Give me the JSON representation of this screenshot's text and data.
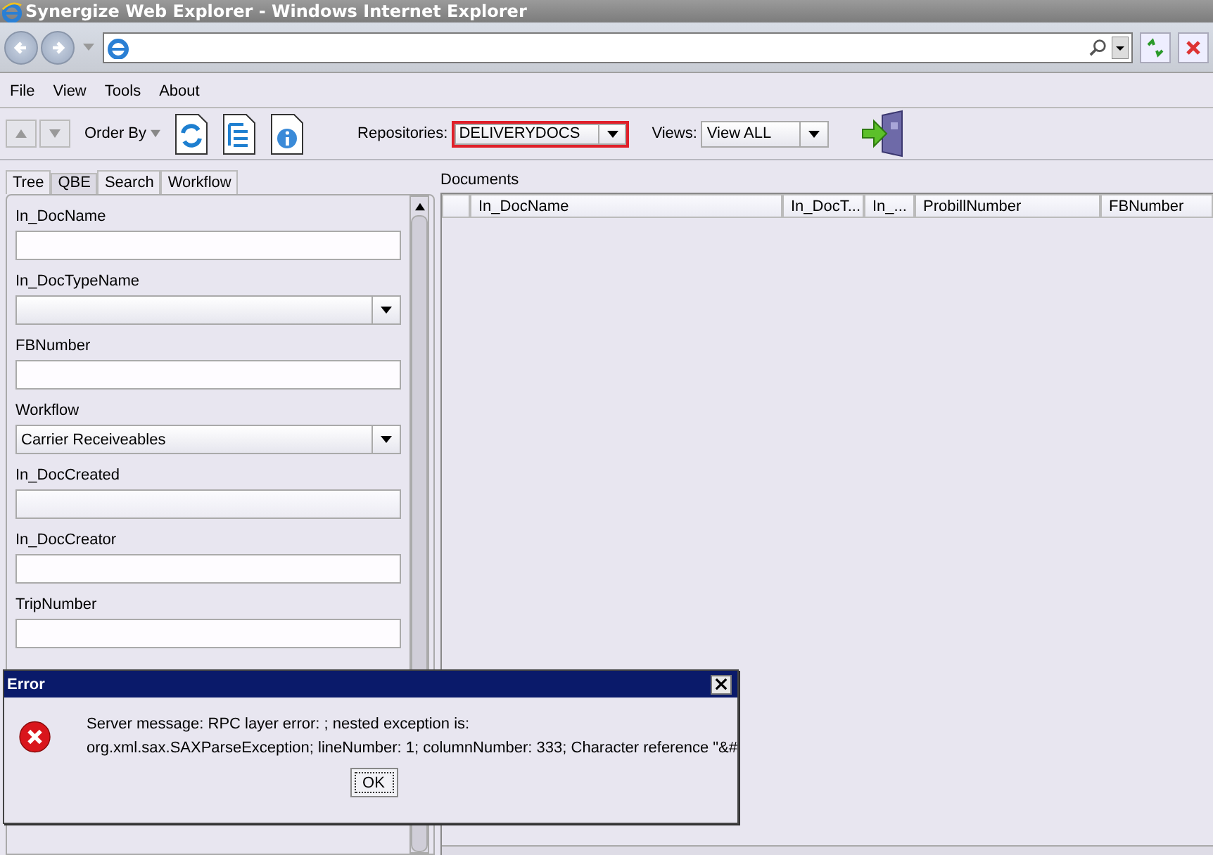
{
  "window": {
    "title": "Synergize Web Explorer - Windows Internet Explorer"
  },
  "menu": [
    "File",
    "View",
    "Tools",
    "About"
  ],
  "toolbar": {
    "order_by": "Order By",
    "repositories_label": "Repositories:",
    "repository": "DELIVERYDOCS",
    "repository_highlighted": true,
    "views_label": "Views:",
    "view": "View ALL"
  },
  "tabs": [
    {
      "label": "Tree",
      "selected": false
    },
    {
      "label": "QBE",
      "selected": true
    },
    {
      "label": "Search",
      "selected": false
    },
    {
      "label": "Workflow",
      "selected": false
    }
  ],
  "fields": [
    {
      "label": "In_DocName",
      "kind": "text"
    },
    {
      "label": "In_DocTypeName",
      "kind": "combo"
    },
    {
      "label": "FBNumber",
      "kind": "text"
    },
    {
      "label": "Workflow",
      "kind": "combo",
      "value": "Carrier Receiveables"
    },
    {
      "label": "In_DocCreated",
      "kind": "date"
    },
    {
      "label": "In_DocCreator",
      "kind": "text"
    },
    {
      "label": "TripNumber",
      "kind": "text"
    }
  ],
  "documents": {
    "title": "Documents",
    "columns": [
      "In_DocName",
      "In_DocT...",
      "In_...",
      "ProbillNumber",
      "FBNumber"
    ]
  },
  "dialog": {
    "title": "Error",
    "lines": [
      "Server message: RPC layer error: ; nested exception is:",
      "org.xml.sax.SAXParseException; lineNumber: 1; columnNumber: 333; Character reference \"&#"
    ],
    "button": "OK"
  }
}
